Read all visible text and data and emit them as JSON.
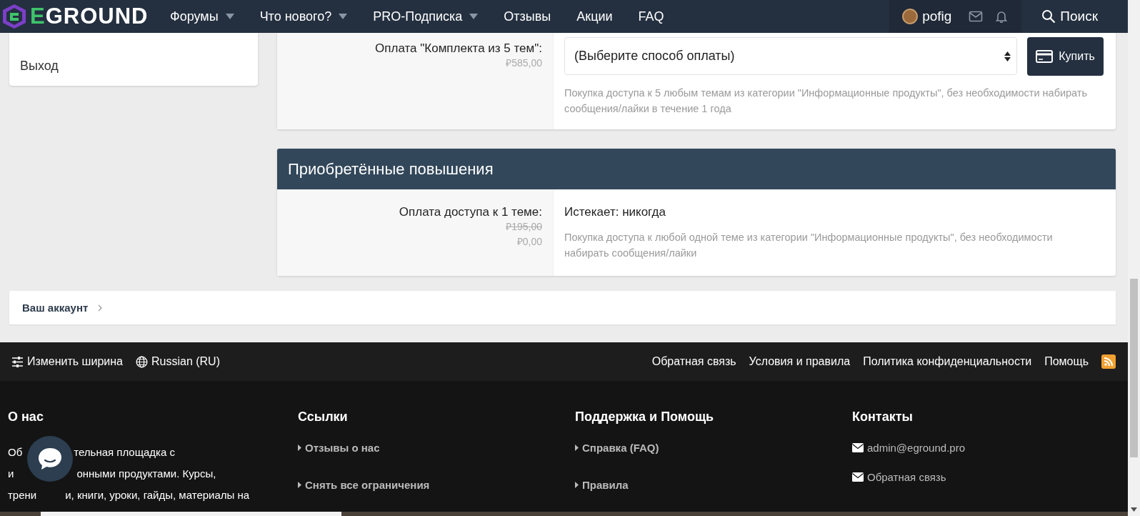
{
  "header": {
    "logo": "EGROUND",
    "nav": [
      {
        "label": "Форумы",
        "has_menu": true
      },
      {
        "label": "Что нового?",
        "has_menu": true
      },
      {
        "label": "PRO-Подписка",
        "has_menu": true
      },
      {
        "label": "Отзывы",
        "has_menu": false
      },
      {
        "label": "Акции",
        "has_menu": false
      },
      {
        "label": "FAQ",
        "has_menu": false
      }
    ],
    "user": "pofig",
    "search": "Поиск"
  },
  "sidebar": {
    "items": [
      "Выход"
    ]
  },
  "offer": {
    "label": "Оплата \"Комплекта из 5 тем\":",
    "prices": [
      {
        "text": "₽585,00",
        "struck": false
      }
    ],
    "select": "(Выберите способ оплаты)",
    "button": "Купить",
    "description": "Покупка доступа к 5 любым темам из категории \"Информационные продукты\", без необходимости набирать сообщения/лайки в течение 1 года"
  },
  "purchased": {
    "title": "Приобретённые повышения",
    "rows": [
      {
        "label": "Оплата доступа к 1 теме:",
        "prices": [
          {
            "text": "₽195,00",
            "struck": true
          },
          {
            "text": "₽0,00",
            "struck": false
          }
        ],
        "status": "Истекает: никогда",
        "description": "Покупка доступа к любой одной теме из категории \"Информационные продукты\", без необходимости набирать сообщения/лайки"
      }
    ]
  },
  "breadcrumb": "Ваш аккаунт",
  "footer_bar": {
    "left": [
      {
        "kind": "sliders",
        "label": "Изменить ширина"
      },
      {
        "kind": "globe",
        "label": "Russian (RU)"
      }
    ],
    "links": [
      "Обратная связь",
      "Условия и правила",
      "Политика конфиденциальности",
      "Помощь"
    ],
    "rss": true
  },
  "footer_columns": [
    {
      "title": "О нас",
      "kind": "text",
      "lines": [
        [
          "Об",
          "тельная площадка с"
        ],
        [
          "и",
          "онными продуктами. Курсы,"
        ],
        [
          "трени",
          "и, книги, уроки, гайды, материалы на"
        ]
      ]
    },
    {
      "title": "Ссылки",
      "kind": "links",
      "items": [
        "Отзывы о нас",
        "Снять все ограничения"
      ]
    },
    {
      "title": "Поддержка и Помощь",
      "kind": "links",
      "items": [
        "Справка (FAQ)",
        "Правила"
      ]
    },
    {
      "title": "Контакты",
      "kind": "contacts",
      "items": [
        "admin@eground.pro",
        "Обратная связь"
      ]
    }
  ]
}
